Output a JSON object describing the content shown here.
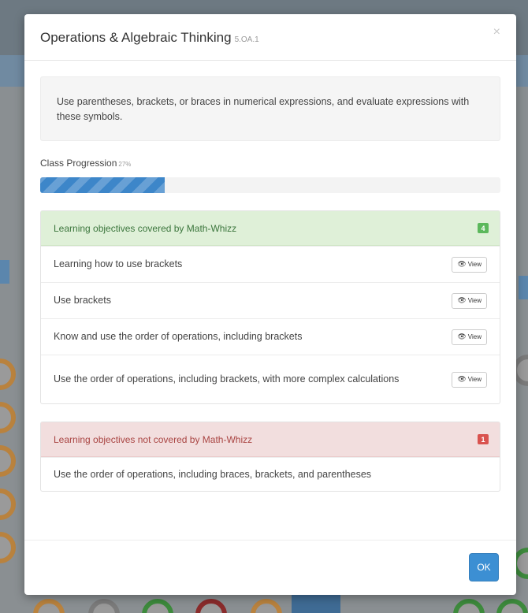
{
  "modal": {
    "title": "Operations & Algebraic Thinking",
    "code": "5.OA.1",
    "close_symbol": "×",
    "description": "Use parentheses, brackets, or braces in numerical expressions, and evaluate expressions with these symbols.",
    "progression": {
      "label": "Class Progression",
      "percent_text": "27%",
      "value": 0.27
    },
    "covered": {
      "heading": "Learning objectives covered by Math-Whizz",
      "count": "4",
      "view_label": "View",
      "items": [
        "Learning how to use brackets",
        "Use brackets",
        "Know and use the order of operations, including brackets",
        "Use the order of operations, including brackets, with more complex calculations"
      ]
    },
    "not_covered": {
      "heading": "Learning objectives not covered by Math-Whizz",
      "count": "1",
      "items": [
        "Use the order of operations, including braces, brackets, and parentheses"
      ]
    },
    "ok_label": "OK"
  },
  "colors": {
    "progress": "#3d86c9",
    "ok_button": "#3c8fd3",
    "success_bg": "#dff0d8",
    "danger_bg": "#f2dede"
  },
  "icons": {
    "view": "eye-icon",
    "close": "close-icon"
  }
}
